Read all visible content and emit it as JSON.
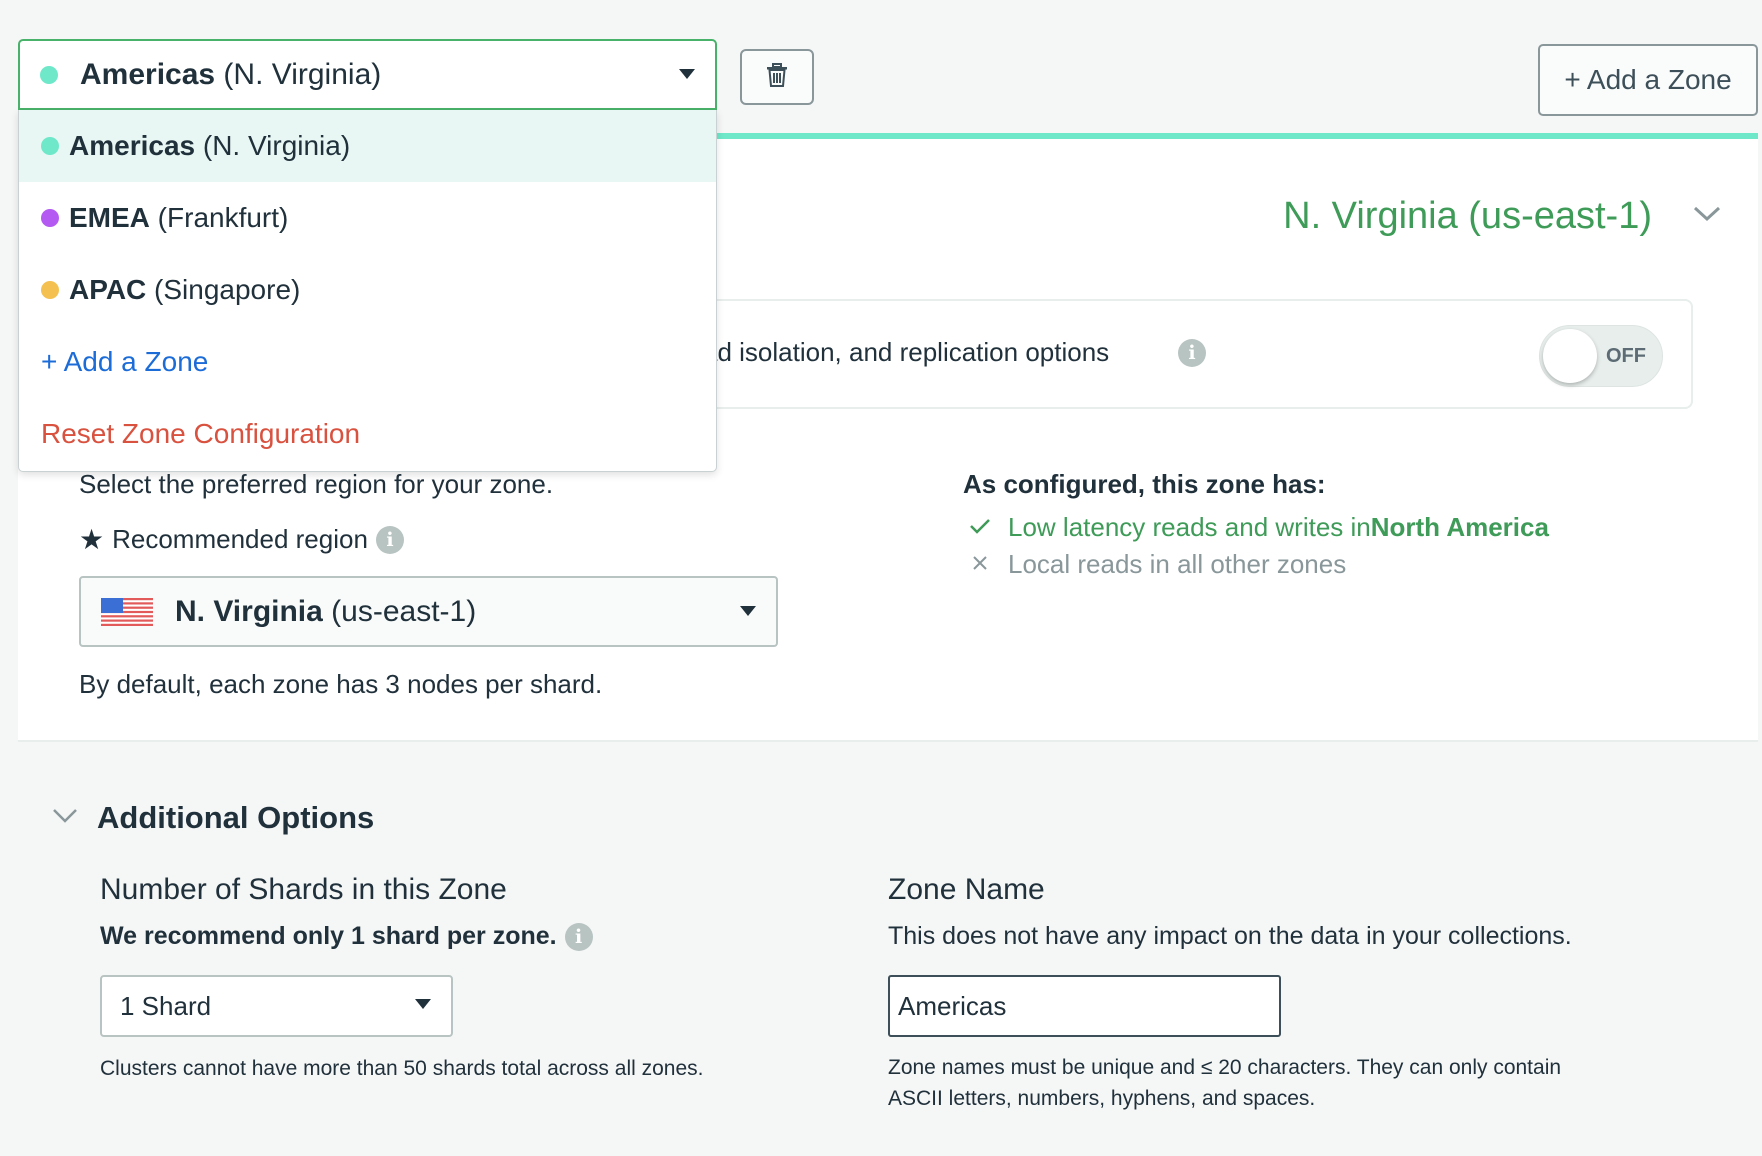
{
  "zone_selector": {
    "name_bold": "Americas",
    "name_rest": " (N. Virginia)",
    "dot_color": "#6ee8c9",
    "icon": "caret-down-icon"
  },
  "delete_icon": "trash-icon",
  "add_zone_button": "+ Add a Zone",
  "dropdown": {
    "items": [
      {
        "bold": "Americas",
        "rest": " (N. Virginia)",
        "dot_color": "#6ee8c9",
        "selected": true
      },
      {
        "bold": "EMEA",
        "rest": " (Frankfurt)",
        "dot_color": "#b45af2",
        "selected": false
      },
      {
        "bold": "APAC",
        "rest": " (Singapore)",
        "dot_color": "#f4c150",
        "selected": false
      }
    ],
    "add_zone": "+ Add a Zone",
    "reset": "Reset Zone Configuration"
  },
  "zone_card": {
    "accent_color": "#6ee8c9",
    "region_title": "N. Virginia (us-east-1)",
    "toggle_text": "ad isolation, and replication options",
    "toggle_state": "OFF",
    "select_hint": "Select the preferred region for your zone.",
    "recommended_label": "Recommended region",
    "region_select": {
      "bold": "N. Virginia",
      "rest": " (us-east-1)",
      "flag": "us-flag-icon"
    },
    "default_note": "By default, each zone has 3 nodes per shard.",
    "configured_title": "As configured, this zone has:",
    "features": [
      {
        "icon": "check-icon",
        "text": "Low latency reads and writes in ",
        "bold": "North America",
        "color": "#3e9b58"
      },
      {
        "icon": "x-icon",
        "text": "Local reads in all other zones",
        "color": "#89979b"
      }
    ]
  },
  "additional_options": {
    "title": "Additional Options",
    "shards": {
      "heading": "Number of Shards in this Zone",
      "recommendation": "We recommend only 1 shard per zone.",
      "selected": "1 Shard",
      "note": "Clusters cannot have more than 50 shards total across all zones."
    },
    "zone_name": {
      "heading": "Zone Name",
      "description": "This does not have any impact on the data in your collections.",
      "value": "Americas",
      "note": "Zone names must be unique and ≤ 20 characters. They can only contain ASCII letters, numbers, hyphens, and spaces."
    }
  }
}
